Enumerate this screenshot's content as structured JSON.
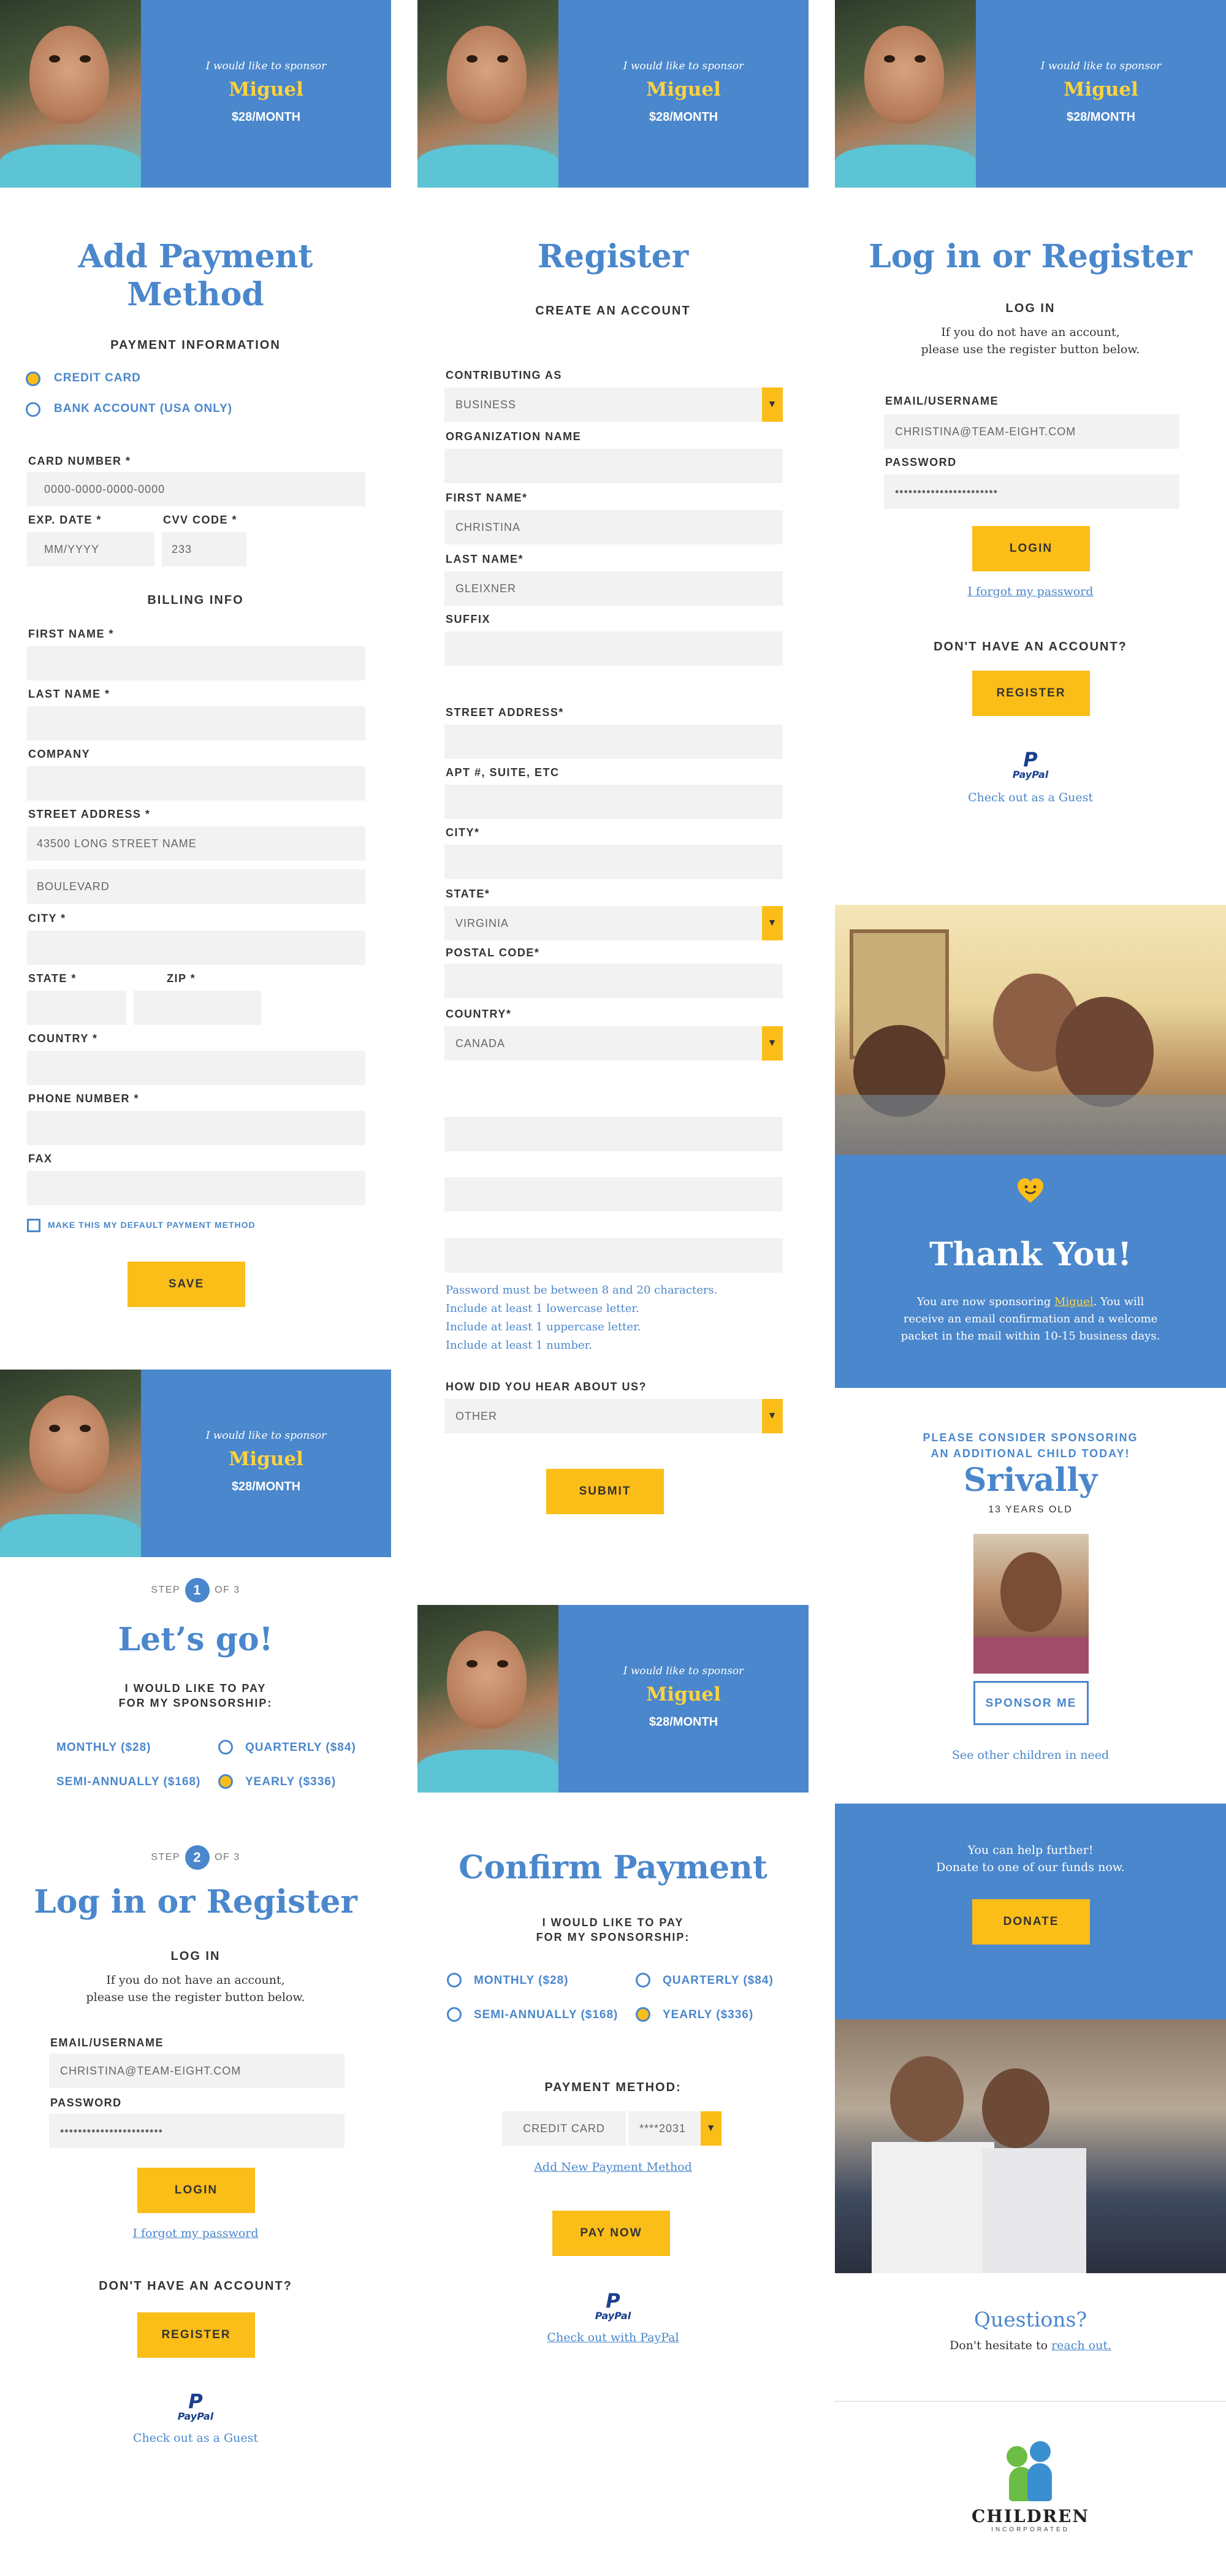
{
  "sponsor": {
    "pre": "I would like to sponsor",
    "name": "Miguel",
    "amount": "$28/MONTH"
  },
  "payment": {
    "title_line1": "Add Payment",
    "title_line2": "Method",
    "info_heading": "PAYMENT INFORMATION",
    "opt_card": "CREDIT CARD",
    "opt_bank": "BANK ACCOUNT (USA ONLY)",
    "card_label": "CARD NUMBER *",
    "card_placeholder": "0000-0000-0000-0000",
    "exp_label": "EXP. DATE *",
    "exp_placeholder": "MM/YYYY",
    "cvv_label": "CVV CODE *",
    "cvv_value": "233",
    "billing_heading": "BILLING INFO",
    "first_label": "FIRST NAME *",
    "last_label": "LAST NAME *",
    "company_label": "COMPANY",
    "street_label": "STREET ADDRESS *",
    "street_value": "43500 LONG STREET NAME",
    "street2_value": "BOULEVARD",
    "city_label": "CITY *",
    "state_label": "STATE *",
    "zip_label": "ZIP *",
    "country_label": "COUNTRY *",
    "phone_label": "PHONE NUMBER *",
    "fax_label": "FAX",
    "default_label": "MAKE THIS MY DEFAULT PAYMENT METHOD",
    "save": "SAVE"
  },
  "register": {
    "title": "Register",
    "sub": "CREATE AN ACCOUNT",
    "contrib_label": "CONTRIBUTING AS",
    "contrib_value": "BUSINESS",
    "org_label": "ORGANIZATION NAME",
    "first_label": "FIRST NAME*",
    "first_value": "CHRISTINA",
    "last_label": "LAST NAME*",
    "last_value": "GLEIXNER",
    "suffix_label": "SUFFIX",
    "street_label": "STREET ADDRESS*",
    "apt_label": "APT #, SUITE, ETC",
    "city_label": "CITY*",
    "state_label": "STATE*",
    "state_value": "VIRGINIA",
    "postal_label": "POSTAL CODE*",
    "country_label": "COUNTRY*",
    "country_value": "CANADA",
    "pwd_hint": [
      "Password must be between 8 and 20 characters.",
      "Include at least 1 lowercase letter.",
      "Include at least 1 uppercase letter.",
      "Include at least 1 number."
    ],
    "hear_label": "HOW DID YOU HEAR ABOUT US?",
    "hear_value": "OTHER",
    "submit": "SUBMIT"
  },
  "login": {
    "title": "Log in or Register",
    "sub": "LOG IN",
    "desc1": "If you do not have an account,",
    "desc2": "please use the register button below.",
    "email_label": "EMAIL/USERNAME",
    "email_value": "CHRISTINA@TEAM-EIGHT.COM",
    "password_label": "PASSWORD",
    "password_value": "•••••••••••••••••••••••",
    "login_btn": "LOGIN",
    "forgot": "I forgot my password",
    "no_account": "DON'T HAVE AN ACCOUNT?",
    "register_btn": "REGISTER",
    "paypal_mark": "P",
    "paypal_word": "PayPal",
    "guest": "Check out as a Guest"
  },
  "letsgo": {
    "step_pre": "STEP",
    "step1": "1",
    "step2": "2",
    "step_post": "OF 3",
    "title": "Let’s go!",
    "pay_line1": "I WOULD LIKE TO PAY",
    "pay_line2": "FOR MY SPONSORSHIP:",
    "monthly": "MONTHLY ($28)",
    "quarterly": "QUARTERLY ($84)",
    "semi": "SEMI-ANNUALLY ($168)",
    "yearly": "YEARLY ($336)"
  },
  "confirm": {
    "title": "Confirm Payment",
    "method_label": "PAYMENT METHOD:",
    "method_value": "CREDIT CARD",
    "card_value": "****2031",
    "add_new": "Add New Payment Method",
    "pay_now": "PAY NOW",
    "paypal_link": "Check out with PayPal"
  },
  "thanks": {
    "title": "Thank You!",
    "line1_a": "You are now sponsoring ",
    "line1_name": "Miguel",
    "line1_b": ". You will",
    "line2": "receive an email confirmation and a welcome",
    "line3": "packet in the mail within 10-15 business days.",
    "consider1": "PLEASE CONSIDER SPONSORING",
    "consider2": "AN ADDITIONAL CHILD TODAY!",
    "child_name": "Srivally",
    "child_age": "13 YEARS OLD",
    "sponsor_btn": "SPONSOR ME",
    "see_other": "See other children in need",
    "help1": "You can help further!",
    "help2": "Donate to one of our funds now.",
    "donate_btn": "DONATE",
    "questions": "Questions?",
    "hesitate": "Don't hesitate to ",
    "reach": "reach out.",
    "logo_main": "CHILDREN",
    "logo_sub": "INCORPORATED"
  },
  "colors": {
    "brand_blue": "#4a87cc",
    "accent_yellow": "#fbbd17",
    "name_yellow": "#ffd23f",
    "field_gray": "#f2f2f2"
  }
}
